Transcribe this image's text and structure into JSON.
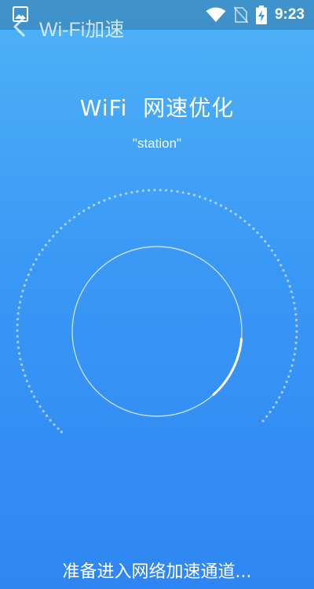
{
  "status_bar": {
    "time": "9:23",
    "icons": [
      "gallery-icon",
      "wifi-icon",
      "no-sim-icon",
      "battery-charging-icon"
    ]
  },
  "app_bar": {
    "title": "Wi-Fi加速",
    "back_icon": "chevron-left-icon"
  },
  "main": {
    "title": "WiFi  网速优化",
    "ssid": "\"station\""
  },
  "gauge": {
    "progress": 0.12
  },
  "footer": {
    "status": "准备进入网络加速通道..."
  },
  "colors": {
    "bg_top": "#4fb3f7",
    "bg_bottom": "#2f86f3",
    "text": "#ffffff"
  }
}
